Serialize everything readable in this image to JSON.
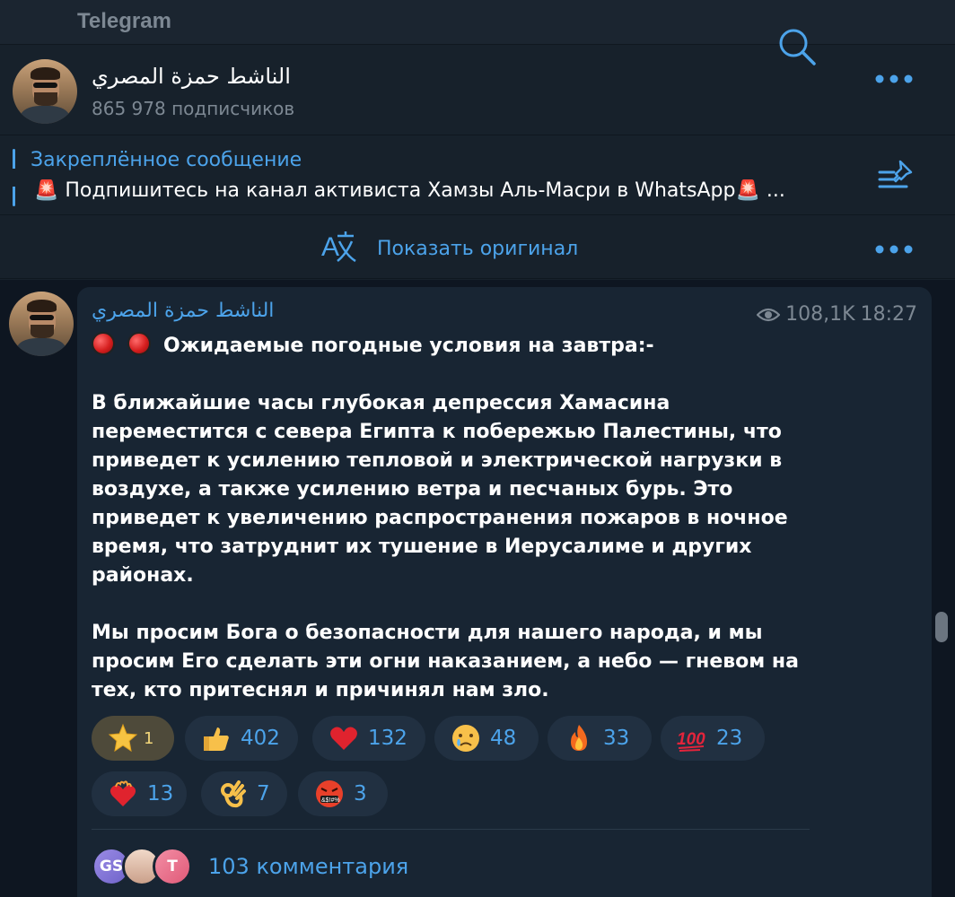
{
  "window": {
    "title": "Telegram"
  },
  "channel": {
    "name": "الناشط حمزة المصري",
    "subscribers": "865 978 подписчиков"
  },
  "pinned": {
    "title": "Закреплённое сообщение",
    "text": "🚨 Подпишитесь на канал активиста Хамзы Аль-Масри в WhatsApp🚨 ..."
  },
  "translate": {
    "label": "Показать оригинал"
  },
  "message": {
    "author": "الناشط حمزة المصري",
    "views": "108,1K",
    "time": "18:27",
    "headline": "Ожидаемые погодные условия на завтра:-",
    "paragraph1": "В ближайшие часы глубокая депрессия Хамасина переместится с севера Египта к побережью Палестины, что приведет к усилению тепловой и электрической нагрузки в воздухе, а также усилению ветра и песчаных бурь. Это приведет к увеличению распространения пожаров в ночное время, что затруднит их тушение в Иерусалиме и других районах.",
    "paragraph2": "Мы просим Бога о безопасности для нашего народа, и мы просим Его сделать эти огни наказанием, а небо — гневом на тех, кто притеснял и причинял нам зло."
  },
  "reactions": [
    {
      "icon": "star-icon",
      "count": "1"
    },
    {
      "icon": "thumbs-up-icon",
      "count": "402"
    },
    {
      "icon": "heart-icon",
      "count": "132"
    },
    {
      "icon": "crying-face-icon",
      "count": "48"
    },
    {
      "icon": "fire-icon",
      "count": "33"
    },
    {
      "icon": "hundred-points-icon",
      "count": "23"
    },
    {
      "icon": "heart-on-fire-icon",
      "count": "13"
    },
    {
      "icon": "ok-hand-icon",
      "count": "7"
    },
    {
      "icon": "cursing-face-icon",
      "count": "3"
    }
  ],
  "comments": {
    "avatars": [
      "GS",
      "T"
    ],
    "label": "103 комментария"
  },
  "colors": {
    "accent": "#4ca3ea",
    "background": "#17212b",
    "message_bg": "#182533",
    "muted": "#7d8893"
  }
}
